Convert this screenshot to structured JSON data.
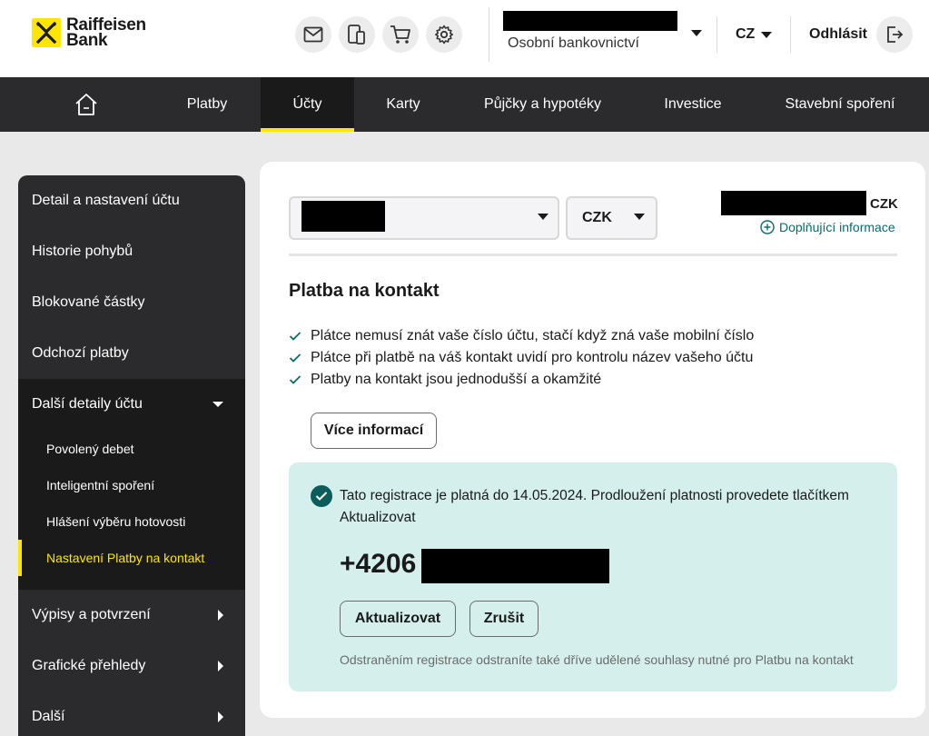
{
  "header": {
    "logo_line1": "Raiffeisen",
    "logo_line2": "Bank",
    "icons": [
      "mail-icon",
      "phone-doc-icon",
      "cart-icon",
      "gear-icon"
    ],
    "account_type": "Osobní bankovnictví",
    "language": "CZ",
    "logout_label": "Odhlásit"
  },
  "nav": {
    "home_icon": "home-icon",
    "items": [
      "Platby",
      "Účty",
      "Karty",
      "Půjčky a hypotéky",
      "Investice",
      "Stavební spoření"
    ],
    "active": "Účty"
  },
  "sidebar": {
    "items": [
      "Detail a nastavení účtu",
      "Historie pohybů",
      "Blokované částky",
      "Odchozí platby",
      "Další detaily účtu"
    ],
    "sub_items": [
      "Povolený debet",
      "Inteligentní spoření",
      "Hlášení výběru hotovosti",
      "Nastavení Platby na kontakt"
    ],
    "active_sub": "Nastavení Platby na kontakt",
    "more_items": [
      "Výpisy a potvrzení",
      "Grafické přehledy",
      "Další"
    ]
  },
  "main": {
    "currency_select": "CZK",
    "balance_currency": "CZK",
    "info_link": "Doplňující informace",
    "title": "Platba na kontakt",
    "bullets": [
      "Plátce nemusí znát vaše číslo účtu, stačí když zná vaše mobilní číslo",
      "Plátce při platbě na váš kontakt uvidí pro kontrolu název vašeho účtu",
      "Platby na kontakt jsou jednodušší a okamžité"
    ],
    "more_info_button": "Více informací",
    "registration": {
      "message": "Tato registrace je platná do 14.05.2024. Prodloužení platnosti provedete tlačítkem Aktualizovat",
      "phone_prefix": "+4206",
      "update_button": "Aktualizovat",
      "cancel_button": "Zrušit",
      "note": "Odstraněním registrace odstraníte také dříve udělené souhlasy nutné pro Platbu na kontakt"
    }
  },
  "colors": {
    "brand_yellow": "#fee600",
    "nav_bg": "#2b2b2d",
    "teal": "#0b6a6a",
    "registration_bg": "#d5f0ec"
  }
}
